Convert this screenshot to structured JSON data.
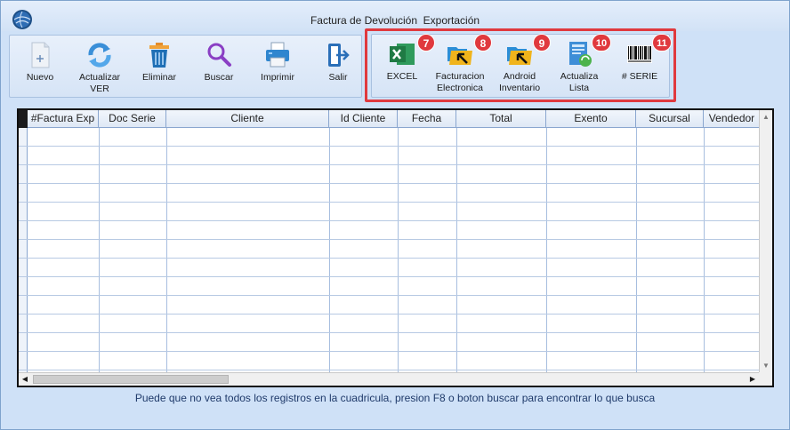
{
  "window": {
    "title": "Factura de Devolución  Exportación"
  },
  "toolbar": {
    "left": [
      {
        "id": "nuevo",
        "label": "Nuevo",
        "icon": "new-document-icon"
      },
      {
        "id": "actualizar",
        "label": "Actualizar\nVER",
        "icon": "refresh-icon"
      },
      {
        "id": "eliminar",
        "label": "Eliminar",
        "icon": "trash-icon"
      },
      {
        "id": "buscar",
        "label": "Buscar",
        "icon": "search-icon"
      },
      {
        "id": "imprimir",
        "label": "Imprimir",
        "icon": "printer-icon"
      },
      {
        "id": "salir",
        "label": "Salir",
        "icon": "exit-icon"
      }
    ],
    "right": [
      {
        "id": "excel",
        "label": "EXCEL",
        "icon": "excel-icon",
        "badge": "7"
      },
      {
        "id": "facturacion",
        "label": "Facturacion\nElectronica",
        "icon": "folder-arrow-icon",
        "badge": "8"
      },
      {
        "id": "android",
        "label": "Android\nInventario",
        "icon": "folder-arrow-icon",
        "badge": "9"
      },
      {
        "id": "actualiza_lista",
        "label": "Actualiza\nLista",
        "icon": "document-refresh-icon",
        "badge": "10"
      },
      {
        "id": "serie",
        "label": "# SERIE",
        "icon": "barcode-icon",
        "badge": "11"
      }
    ]
  },
  "grid": {
    "columns": [
      "#Factura Exp",
      "Doc Serie",
      "Cliente",
      "Id Cliente",
      "Fecha",
      "Total",
      "Exento",
      "Sucursal",
      "Vendedor"
    ],
    "rows": []
  },
  "status": {
    "message": "Puede que no vea todos los registros en la cuadricula, presion F8 o boton buscar para encontrar lo que busca"
  },
  "colors": {
    "accent_red": "#e0393e",
    "window_bg": "#cfe1f7",
    "grid_line": "#a7bedf",
    "excel_green": "#1f7a44"
  }
}
